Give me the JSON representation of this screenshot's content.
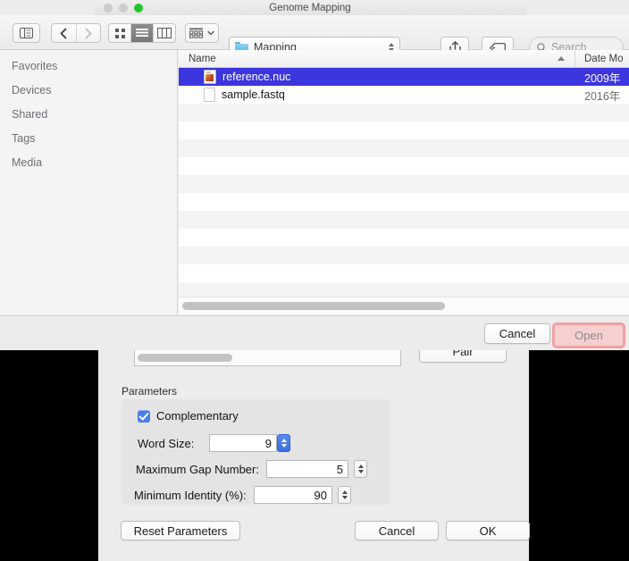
{
  "window": {
    "title": "Genome Mapping",
    "traffic_lights": [
      "close",
      "minimize",
      "zoom"
    ]
  },
  "toolbar": {
    "sidebar_toggle_icon": "sidebar-toggle-icon",
    "back_icon": "chevron-left-icon",
    "forward_icon": "chevron-right-icon",
    "view_icon_grid": "icon-view-icon",
    "view_list": "list-view-icon",
    "view_columns": "column-view-icon",
    "arrange_icon": "arrange-by-icon",
    "path_label": "Mapping",
    "path_folder_icon": "folder-icon",
    "path_chevrons_icon": "chevron-up-down-icon",
    "share_icon": "share-icon",
    "tag_icon": "tag-icon",
    "search_placeholder": "Search",
    "search_icon": "search-icon",
    "search_value": ""
  },
  "sidebar": {
    "items": [
      {
        "label": "Favorites"
      },
      {
        "label": "Devices"
      },
      {
        "label": "Shared"
      },
      {
        "label": "Tags"
      },
      {
        "label": "Media"
      }
    ]
  },
  "filelist": {
    "columns": [
      {
        "label": "Name",
        "sort": "ascending"
      },
      {
        "label": "Date Mo"
      }
    ],
    "rows": [
      {
        "name": "reference.nuc",
        "date": "2009年",
        "icon": "nuc-file-icon",
        "selected": true
      },
      {
        "name": "sample.fastq",
        "date": "2016年",
        "icon": "document-file-icon",
        "selected": false
      }
    ],
    "empty_row_count": 11
  },
  "sheet_footer": {
    "cancel_label": "Cancel",
    "open_label": "Open"
  },
  "background_dialog": {
    "pair_button_label": "Pair",
    "parameters_group_label": "Parameters",
    "complementary": {
      "label": "Complementary",
      "checked": true
    },
    "fields": [
      {
        "label": "Word Size:",
        "value": "9",
        "stepper": "blue"
      },
      {
        "label": "Maximum Gap Number:",
        "value": "5",
        "stepper": "gray"
      },
      {
        "label": "Minimum Identity (%):",
        "value": "90",
        "stepper": "gray"
      }
    ],
    "buttons": {
      "reset_label": "Reset Parameters",
      "cancel_label": "Cancel",
      "ok_label": "OK"
    }
  },
  "colors": {
    "selection_blue": "#3b36de",
    "stepper_blue": "#4a7fe8",
    "open_highlight": "#f0a0a0",
    "window_chrome": "#ececec"
  }
}
